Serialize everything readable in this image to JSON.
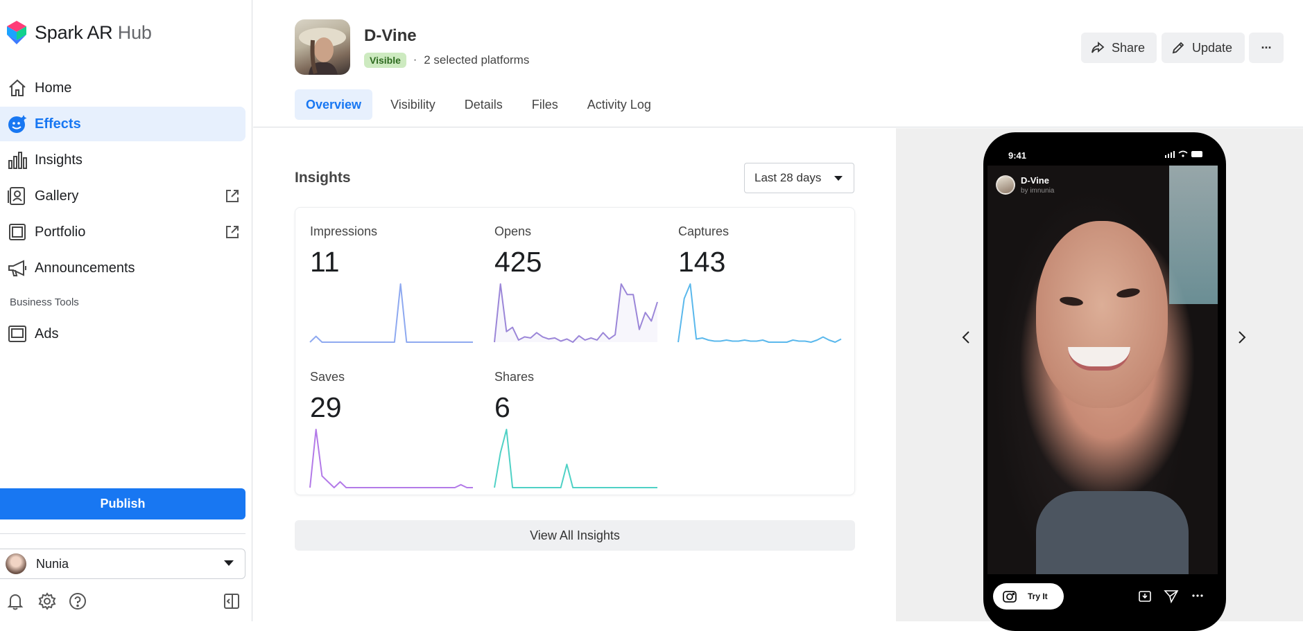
{
  "brand": {
    "name": "Spark AR",
    "suffix": "Hub"
  },
  "sidebar": {
    "items": [
      {
        "label": "Home",
        "icon": "home-icon"
      },
      {
        "label": "Effects",
        "icon": "effects-icon",
        "active": true
      },
      {
        "label": "Insights",
        "icon": "insights-icon"
      },
      {
        "label": "Gallery",
        "icon": "gallery-icon",
        "external": true
      },
      {
        "label": "Portfolio",
        "icon": "portfolio-icon",
        "external": true
      },
      {
        "label": "Announcements",
        "icon": "megaphone-icon"
      }
    ],
    "section_label": "Business Tools",
    "business_items": [
      {
        "label": "Ads",
        "icon": "ads-icon"
      }
    ],
    "publish_label": "Publish",
    "account_name": "Nunia",
    "bottom_icons": [
      "bell-icon",
      "gear-icon",
      "help-icon",
      "collapse-sidebar-icon"
    ]
  },
  "header": {
    "title": "D-Vine",
    "status_badge": "Visible",
    "separator": "·",
    "platforms_text": "2 selected platforms",
    "tabs": [
      "Overview",
      "Visibility",
      "Details",
      "Files",
      "Activity Log"
    ],
    "active_tab": "Overview",
    "share_label": "Share",
    "update_label": "Update",
    "more_label": "···"
  },
  "insights": {
    "title": "Insights",
    "range_label": "Last 28 days",
    "view_all_label": "View All Insights",
    "metrics": [
      {
        "label": "Impressions",
        "value": "11",
        "color": "#8ea9f0",
        "series": [
          0,
          1,
          0,
          0,
          0,
          0,
          0,
          0,
          0,
          0,
          0,
          0,
          0,
          0,
          0,
          10,
          0,
          0,
          0,
          0,
          0,
          0,
          0,
          0,
          0,
          0,
          0,
          0
        ]
      },
      {
        "label": "Opens",
        "value": "425",
        "color": "#9b86d8",
        "fill": true,
        "series": [
          0,
          55,
          10,
          14,
          2,
          5,
          4,
          9,
          5,
          3,
          4,
          1,
          3,
          0,
          6,
          2,
          4,
          2,
          9,
          3,
          7,
          55,
          45,
          45,
          12,
          28,
          20,
          38
        ]
      },
      {
        "label": "Captures",
        "value": "143",
        "color": "#5ab8ec",
        "series": [
          0,
          42,
          56,
          3,
          4,
          2,
          1,
          1,
          2,
          1,
          1,
          2,
          1,
          1,
          2,
          0,
          0,
          0,
          0,
          2,
          1,
          1,
          0,
          2,
          5,
          2,
          0,
          3
        ]
      },
      {
        "label": "Saves",
        "value": "29",
        "color": "#b37ae8",
        "series": [
          0,
          10,
          2,
          1,
          0,
          1,
          0,
          0,
          0,
          0,
          0,
          0,
          0,
          0,
          0,
          0,
          0,
          0,
          0,
          0,
          0,
          0,
          0,
          0,
          0,
          0.5,
          0,
          0
        ]
      },
      {
        "label": "Shares",
        "value": "6",
        "color": "#4fd1c5",
        "series": [
          0,
          3,
          5,
          0,
          0,
          0,
          0,
          0,
          0,
          0,
          0,
          0,
          2,
          0,
          0,
          0,
          0,
          0,
          0,
          0,
          0,
          0,
          0,
          0,
          0,
          0,
          0,
          0
        ]
      }
    ]
  },
  "preview": {
    "status_time": "9:41",
    "effect_name": "D-Vine",
    "creator_text": "by imnunia",
    "try_it_label": "Try It"
  }
}
